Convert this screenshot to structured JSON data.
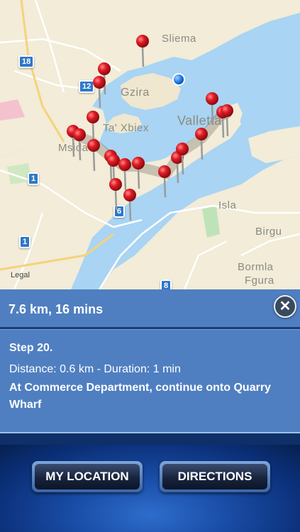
{
  "map": {
    "labels": [
      "Sliema",
      "Gzira",
      "Ta' Xbiex",
      "Valletta",
      "Isla",
      "Birgu",
      "Bormla",
      "Fgura",
      "Msida"
    ],
    "shields": [
      "18",
      "12",
      "1",
      "1",
      "6",
      "8"
    ],
    "legal": "Legal"
  },
  "route": {
    "summary": "7.6 km, 16 mins",
    "close_icon": "close-icon"
  },
  "step": {
    "title": "Step 20.",
    "distance": "Distance: 0.6 km - Duration: 1 min",
    "instruction": "At Commerce Department, continue onto Quarry Wharf"
  },
  "buttons": {
    "my_location": "MY LOCATION",
    "directions": "DIRECTIONS"
  },
  "colors": {
    "panel": "#4f7fc1",
    "pin": "#e01b24",
    "user_dot": "#1e7be8"
  }
}
